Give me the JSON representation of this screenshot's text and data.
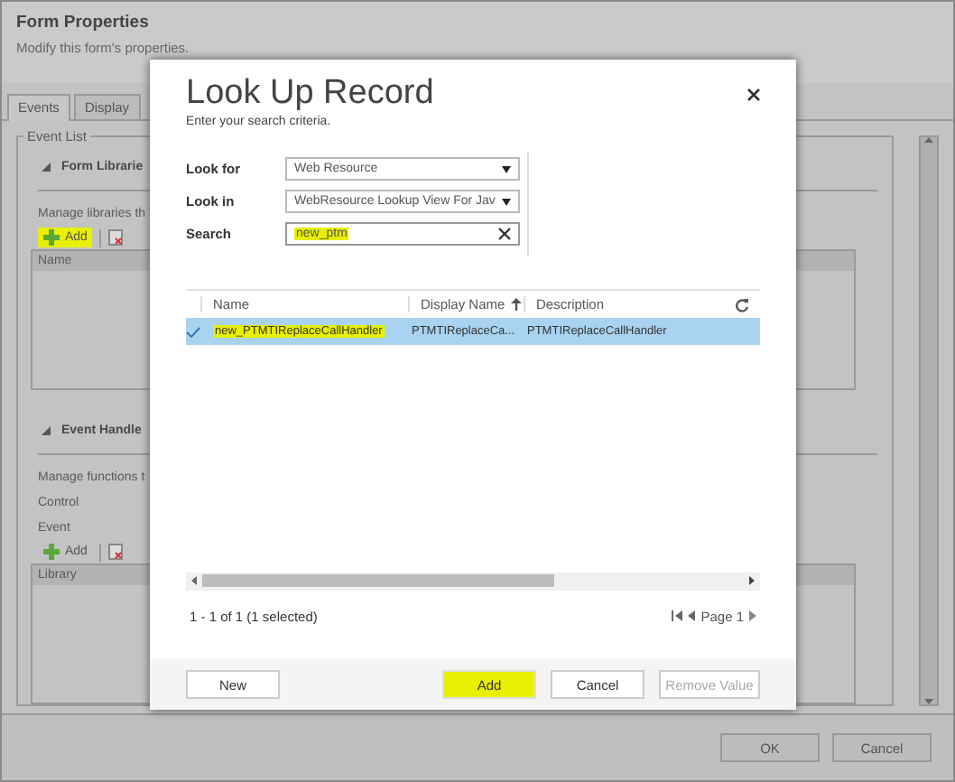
{
  "form_window": {
    "title": "Form Properties",
    "subtitle": "Modify this form's properties.",
    "tabs": [
      {
        "label": "Events",
        "selected": true
      },
      {
        "label": "Display",
        "selected": false
      }
    ],
    "event_list": {
      "legend": "Event List",
      "sections": [
        {
          "title": "Form Librarie",
          "expanded": true,
          "description": "Manage libraries th",
          "add_button": {
            "label": "Add",
            "highlighted": true
          },
          "list_header": "Name"
        },
        {
          "title": "Event Handle",
          "expanded": true,
          "description": "Manage functions t",
          "fields": [
            "Control",
            "Event"
          ],
          "add_button": {
            "label": "Add",
            "highlighted": false
          },
          "list_header": "Library"
        }
      ]
    },
    "buttons": [
      {
        "label": "OK"
      },
      {
        "label": "Cancel"
      }
    ]
  },
  "dialog": {
    "title": "Look Up Record",
    "subtitle": "Enter your search criteria.",
    "criteria": [
      {
        "label": "Look for",
        "kind": "select",
        "value": "Web Resource"
      },
      {
        "label": "Look in",
        "kind": "select",
        "value": "WebResource Lookup View For Jav"
      },
      {
        "label": "Search",
        "kind": "search",
        "value": "new_ptm",
        "highlighted": true
      }
    ],
    "columns": [
      {
        "label": "Name",
        "sorted": false
      },
      {
        "label": "Display Name",
        "sorted": true
      },
      {
        "label": "Description",
        "sorted": false
      }
    ],
    "rows": [
      {
        "selected": true,
        "cells": [
          {
            "text": "new_PTMTIReplaceCallHandler",
            "highlighted": true
          },
          {
            "text": "PTMTIReplaceCa...",
            "highlighted": false
          },
          {
            "text": "PTMTIReplaceCallHandler",
            "highlighted": false
          }
        ]
      }
    ],
    "status": "1 - 1 of 1 (1 selected)",
    "page": "Page 1",
    "buttons": [
      {
        "label": "New",
        "highlighted": false,
        "disabled": false
      },
      {
        "label": "Add",
        "highlighted": true,
        "disabled": false
      },
      {
        "label": "Cancel",
        "highlighted": false,
        "disabled": false
      },
      {
        "label": "Remove Value",
        "highlighted": false,
        "disabled": true
      }
    ]
  }
}
